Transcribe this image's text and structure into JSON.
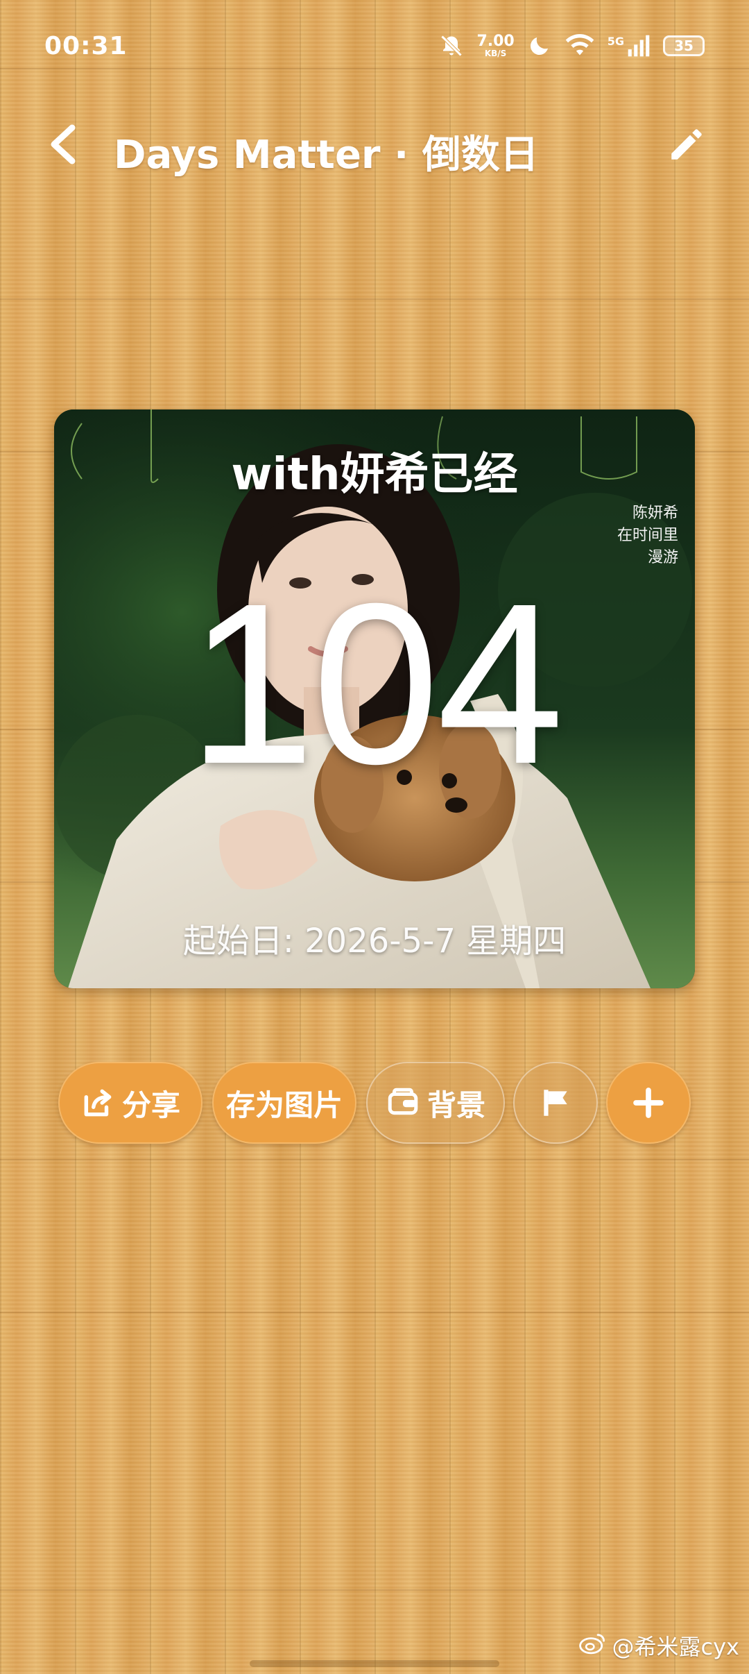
{
  "status_bar": {
    "time": "00:31",
    "net_speed_value": "7.00",
    "net_speed_unit": "KB/S",
    "signal_label": "5G",
    "battery": "35"
  },
  "header": {
    "title": "Days Matter · 倒数日"
  },
  "card": {
    "title": "with妍希已经",
    "days": "104",
    "start_date": "起始日: 2026-5-7 星期四",
    "magazine_caption": [
      "陈妍希",
      "在时间里",
      "漫游"
    ]
  },
  "actions": {
    "share": "分享",
    "save_image": "存为图片",
    "background": "背景"
  },
  "watermark": "@希米露cyx",
  "colors": {
    "button_orange": "#eda042",
    "wood": "#e2ae62"
  },
  "icons": [
    "notifications-off-icon",
    "moon-icon",
    "wifi-icon",
    "signal-icon",
    "battery-icon",
    "back-icon",
    "edit-icon",
    "share-icon",
    "wallpaper-icon",
    "flag-icon",
    "add-icon",
    "weibo-icon"
  ]
}
